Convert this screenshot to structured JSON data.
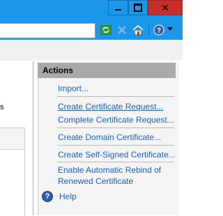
{
  "actions": {
    "header": "Actions",
    "items": [
      {
        "label": "Import..."
      },
      {
        "label": "Create Certificate Request..."
      },
      {
        "label": "Complete Certificate Request..."
      },
      {
        "label": "Create Domain Certificate..."
      },
      {
        "label": "Create Self-Signed Certificate..."
      },
      {
        "label": "Enable Automatic Rebind of Renewed Certificate"
      },
      {
        "label": "Help"
      }
    ]
  },
  "left_pane": {
    "stub_text": "s"
  },
  "colors": {
    "title_bar": "#1c97ea",
    "close_button": "#c7302a",
    "link": "#1a5fb4",
    "actions_header_bg": "#a9a9a9"
  },
  "icons": [
    "minimize-icon",
    "maximize-icon",
    "close-icon",
    "refresh-icon",
    "stop-icon",
    "home-icon",
    "help-icon",
    "chevron-down-icon"
  ]
}
